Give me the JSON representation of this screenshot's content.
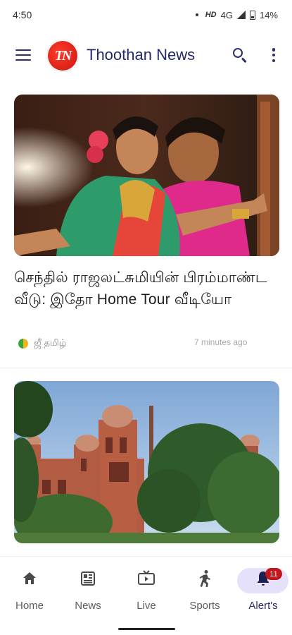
{
  "status_bar": {
    "time": "4:50",
    "network": "HD",
    "signal_label": "4G",
    "battery": "14%"
  },
  "app_bar": {
    "logo_text": "TN",
    "title": "Thoothan News",
    "icons": [
      "menu-icon",
      "search-icon",
      "more-vert-icon"
    ]
  },
  "feed": {
    "articles": [
      {
        "headline": "செந்தில் ராஜலட்சுமியின் பிரம்மாண்ட வீடு: இதோ Home Tour வீடியோ",
        "source": "ஜீ தமிழ்",
        "time": "7 minutes ago"
      },
      {
        "headline": "",
        "source": "",
        "time": ""
      }
    ]
  },
  "bottom_nav": {
    "items": [
      {
        "label": "Home",
        "icon": "home-icon"
      },
      {
        "label": "News",
        "icon": "newspaper-icon"
      },
      {
        "label": "Live",
        "icon": "tv-icon"
      },
      {
        "label": "Sports",
        "icon": "running-icon"
      },
      {
        "label": "Alert's",
        "icon": "bell-icon",
        "badge": "11",
        "active": true
      }
    ]
  },
  "colors": {
    "brand_navy": "#27286b",
    "logo_red": "#d8231a",
    "active_pill": "#e6e1fb",
    "badge_red": "#c4151b"
  }
}
